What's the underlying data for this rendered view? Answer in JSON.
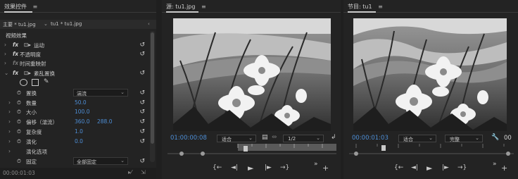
{
  "effect_controls": {
    "title": "效果控件",
    "menu_icon": "≡",
    "seq_label": "主要 * tu1.jpg",
    "seq_sep": "⌄",
    "clip_label": "tu1 * tu1.jpg",
    "video_effects_label": "视频效果",
    "effects": [
      {
        "fx": "fx",
        "name": "运动"
      },
      {
        "fx": "fx",
        "name": "不透明度"
      },
      {
        "fx": "fx",
        "name": "时间重映射"
      },
      {
        "fx": "fx",
        "name": "紊乱置换"
      }
    ],
    "params": [
      {
        "name": "置换",
        "value": "湍流",
        "type": "dropdown"
      },
      {
        "name": "数量",
        "value": "50.0"
      },
      {
        "name": "大小",
        "value": "100.0"
      },
      {
        "name": "偏移（湍流）",
        "value": "360.0",
        "value2": "288.0"
      },
      {
        "name": "复杂度",
        "value": "1.0"
      },
      {
        "name": "演化",
        "value": "0.0"
      },
      {
        "name": "演化选项",
        "value": ""
      },
      {
        "name": "固定",
        "value": "全部固定",
        "type": "dropdown"
      }
    ],
    "timecode": "00:00:01:03"
  },
  "source_monitor": {
    "title": "源: tu1.jpg",
    "menu_icon": "≡",
    "timecode": "01:00:00:08",
    "fit": "适合",
    "resolution": "1/2",
    "more": "»",
    "add": "+"
  },
  "program_monitor": {
    "title": "节目: tu1",
    "menu_icon": "≡",
    "timecode": "00:00:01:03",
    "fit": "适合",
    "quality": "完整",
    "end_timecode": "00",
    "more": "»",
    "add": "+"
  },
  "transport": {
    "mark_in": "{←",
    "step_back": "◄|",
    "play": "►",
    "step_fwd": "|►",
    "mark_out": "→}"
  }
}
